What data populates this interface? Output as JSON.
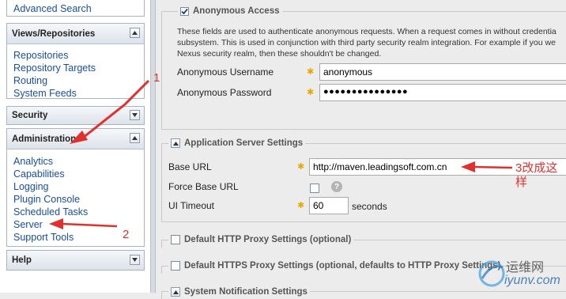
{
  "sidebar": {
    "search": {
      "link": "Advanced Search"
    },
    "views": {
      "title": "Views/Repositories",
      "items": [
        "Repositories",
        "Repository Targets",
        "Routing",
        "System Feeds"
      ]
    },
    "security": {
      "title": "Security"
    },
    "administration": {
      "title": "Administration",
      "items": [
        "Analytics",
        "Capabilities",
        "Logging",
        "Plugin Console",
        "Scheduled Tasks",
        "Server",
        "Support Tools"
      ]
    },
    "help": {
      "title": "Help"
    }
  },
  "anonymous": {
    "title": "Anonymous Access",
    "checked": true,
    "description_lines": [
      "These fields are used to authenticate anonymous requests. When a request comes in without credentia",
      "subsystem. This is used in conjunction with third party security realm integration. For example if you we",
      "Nexus security realm, then these shouldn't be changed."
    ],
    "username_label": "Anonymous Username",
    "username_value": "anonymous",
    "password_label": "Anonymous Password",
    "password_value": "●●●●●●●●●●●●●●●"
  },
  "app_server": {
    "title": "Application Server Settings",
    "base_url_label": "Base URL",
    "base_url_value": "http://maven.leadingsoft.com.cn",
    "force_label": "Force Base URL",
    "force_checked": false,
    "timeout_label": "UI Timeout",
    "timeout_value": "60",
    "timeout_unit": "seconds"
  },
  "proxy_http": {
    "title": "Default HTTP Proxy Settings (optional)"
  },
  "proxy_https": {
    "title": "Default HTTPS Proxy Settings (optional, defaults to HTTP Proxy Settings)"
  },
  "notification": {
    "title": "System Notification Settings"
  },
  "annotations": {
    "one": "1",
    "two": "2",
    "three_line1": "3改成这",
    "three_line2": "样"
  },
  "watermark": {
    "text_cn": "运维网",
    "text_en": "iyunv.com"
  },
  "colors": {
    "annotation": "#e0312f",
    "link": "#1a4fa0",
    "required": "#e8a800"
  },
  "icons": {
    "expand": "chevron-up-icon",
    "collapse": "chevron-down-icon",
    "help": "help-icon",
    "required": "star-icon"
  }
}
